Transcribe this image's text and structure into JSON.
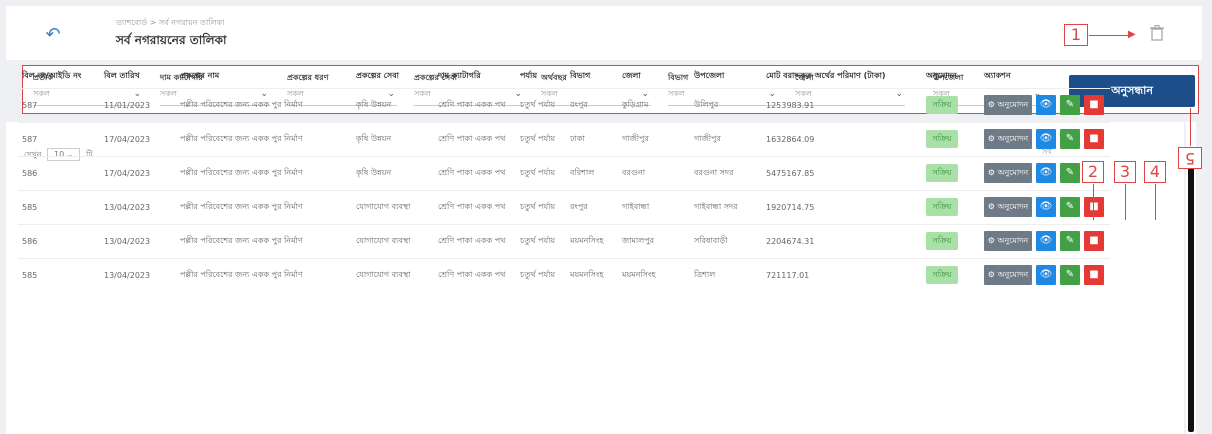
{
  "header": {
    "breadcrumb": "ড্যাশবোর্ড > সর্ব নগরায়ন তালিকা",
    "title": "সর্ব নগরায়নের তালিকা"
  },
  "filters": [
    {
      "label": "প্রতীক",
      "value": "সকল"
    },
    {
      "label": "দাম ক্যাটাগরি",
      "value": "সকল"
    },
    {
      "label": "প্রকল্পের ধরণ",
      "value": "সকল"
    },
    {
      "label": "প্রকল্পের সেবা",
      "value": "সকল"
    },
    {
      "label": "অর্থবছর",
      "value": "সকল"
    },
    {
      "label": "বিভাগ",
      "value": "সকল"
    },
    {
      "label": "জেলা",
      "value": "সকল"
    },
    {
      "label": "উপজেলা",
      "value": "সকল"
    }
  ],
  "search_button": "অনুসন্ধান",
  "list": {
    "page_size_label": "দেখুন",
    "page_size_value": "10",
    "page_size_suffix": "টি",
    "rows_info": "সর্ব"
  },
  "table": {
    "headers": [
      "বিল নং/আইডি নং",
      "বিল তারিখ",
      "প্রকল্পের নাম",
      "প্রকল্পের সেবা",
      "দাম ক্যাটাগরি",
      "পর্যায়",
      "বিভাগ",
      "জেলা",
      "উপজেলা",
      "মোট বরাদ্দকৃত অর্থের পরিমাণ (টাকা)",
      "অনুমোদন",
      "অ্যাকশন"
    ],
    "rows": [
      [
        "587",
        "11/01/2023",
        "পল্লীর পরিবেশের জন্য একক পুর নির্মাণ",
        "কৃষি উন্নয়ন",
        "শ্রেণি পাকা একক পথ",
        "চতুর্থ পর্যায়",
        "রংপুর",
        "কুড়িগ্রাম",
        "উলিপুর",
        "1253983.91"
      ],
      [
        "587",
        "17/04/2023",
        "পল্লীর পরিবেশের জন্য একক পুর নির্মাণ",
        "কৃষি উন্নয়ন",
        "শ্রেণি পাকা একক পথ",
        "চতুর্থ পর্যায়",
        "ঢাকা",
        "গাজীপুর",
        "গাজীপুর",
        "1632864.09"
      ],
      [
        "586",
        "17/04/2023",
        "পল্লীর পরিবেশের জন্য একক পুর নির্মাণ",
        "কৃষি উন্নয়ন",
        "শ্রেণি পাকা একক পথ",
        "চতুর্থ পর্যায়",
        "বরিশাল",
        "বরগুনা",
        "বরগুনা সদর",
        "5475167.85"
      ],
      [
        "585",
        "13/04/2023",
        "পল্লীর পরিবেশের জন্য একক পুর নির্মাণ",
        "যোগাযোগ ব্যবস্থা",
        "শ্রেণি পাকা একক পথ",
        "চতুর্থ পর্যায়",
        "রংপুর",
        "গাইবান্ধা",
        "গাইবান্ধা সদর",
        "1920714.75"
      ],
      [
        "586",
        "13/04/2023",
        "পল্লীর পরিবেশের জন্য একক পুর নির্মাণ",
        "যোগাযোগ ব্যবস্থা",
        "শ্রেণি পাকা একক পথ",
        "চতুর্থ পর্যায়",
        "ময়মনসিংহ",
        "জামালপুর",
        "সরিষাবাড়ী",
        "2204674.31"
      ],
      [
        "585",
        "13/04/2023",
        "পল্লীর পরিবেশের জন্য একক পুর নির্মাণ",
        "যোগাযোগ ব্যবস্থা",
        "শ্রেণি পাকা একক পথ",
        "চতুর্থ পর্যায়",
        "ময়মনসিংহ",
        "ময়মনসিংহ",
        "ত্রিশাল",
        "721117.01"
      ]
    ],
    "status_label": "সক্রিয়",
    "approve_label": "অনুমোদন"
  },
  "callouts": [
    "1",
    "2",
    "3",
    "4",
    "5"
  ],
  "colors": {
    "primary": "#1d4e89",
    "view": "#1e88e5",
    "edit": "#43a047",
    "delete": "#e53935",
    "status_green": "#a8e0a8",
    "annotation_red": "#e04545"
  },
  "icons": {
    "back": "back-arrow-icon",
    "trash": "trash-icon",
    "view": "eye-icon",
    "edit": "pencil-icon",
    "delete": "delete-icon"
  }
}
